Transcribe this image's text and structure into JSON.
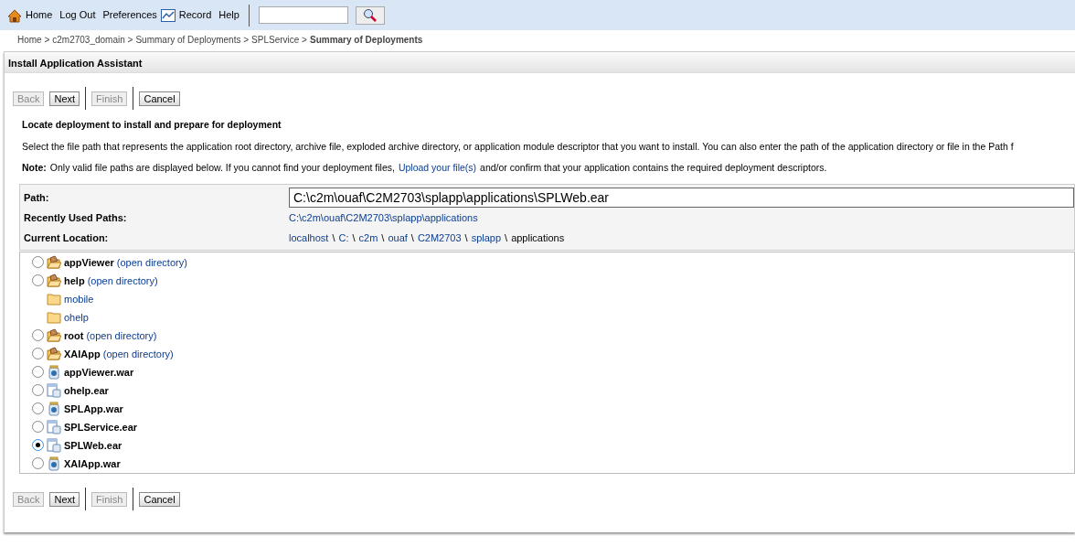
{
  "toolbar": {
    "links": [
      "Home",
      "Log Out",
      "Preferences",
      "Record",
      "Help"
    ]
  },
  "breadcrumb": [
    {
      "text": "Home >",
      "current": false
    },
    {
      "text": "c2m2703_domain >",
      "current": false
    },
    {
      "text": "Summary of Deployments >",
      "current": false
    },
    {
      "text": "SPLService >",
      "current": false
    },
    {
      "text": "Summary of Deployments",
      "current": true
    }
  ],
  "panel": {
    "title": "Install Application Assistant",
    "buttons_top": [
      {
        "label": "Back",
        "disabled": true
      },
      {
        "label": "Next",
        "disabled": false
      },
      {
        "label": "Finish",
        "disabled": true
      },
      {
        "label": "Cancel",
        "disabled": false
      }
    ],
    "heading": "Locate deployment to install and prepare for deployment",
    "description": "Select the file path that represents the application root directory, archive file, exploded archive directory, or application module descriptor that you want to install. You can also enter the path of the application directory or file in the Path f",
    "note": {
      "label": "Note:",
      "before": "Only valid file paths are displayed below. If you cannot find your deployment files,",
      "link": "Upload your file(s)",
      "after": "and/or confirm that your application contains the required deployment descriptors."
    },
    "path": {
      "label": "Path:",
      "value": "C:\\c2m\\ouaf\\C2M2703\\splapp\\applications\\SPLWeb.ear"
    },
    "recent": {
      "label": "Recently Used Paths:",
      "value": "C:\\c2m\\ouaf\\C2M2703\\splapp\\applications"
    },
    "location": {
      "label": "Current Location:",
      "segments": [
        {
          "text": "localhost",
          "kind": "link"
        },
        {
          "text": "\\",
          "kind": "sep"
        },
        {
          "text": "C:",
          "kind": "link"
        },
        {
          "text": "\\",
          "kind": "sep"
        },
        {
          "text": "c2m",
          "kind": "link"
        },
        {
          "text": "\\",
          "kind": "sep"
        },
        {
          "text": "ouaf",
          "kind": "link"
        },
        {
          "text": "\\",
          "kind": "sep"
        },
        {
          "text": "C2M2703",
          "kind": "link"
        },
        {
          "text": "\\",
          "kind": "sep"
        },
        {
          "text": "splapp",
          "kind": "link"
        },
        {
          "text": "\\",
          "kind": "sep"
        },
        {
          "text": "applications",
          "kind": "text"
        }
      ]
    },
    "items": [
      {
        "kind": "directory",
        "name": "appViewer",
        "action": "(open directory)",
        "selected": false
      },
      {
        "kind": "directory",
        "name": "help",
        "action": "(open directory)",
        "selected": false,
        "children": [
          {
            "kind": "folder",
            "name": "mobile"
          },
          {
            "kind": "folder",
            "name": "ohelp"
          }
        ]
      },
      {
        "kind": "directory",
        "name": "root",
        "action": "(open directory)",
        "selected": false
      },
      {
        "kind": "directory",
        "name": "XAIApp",
        "action": "(open directory)",
        "selected": false
      },
      {
        "kind": "war",
        "name": "appViewer.war",
        "selected": false
      },
      {
        "kind": "ear",
        "name": "ohelp.ear",
        "selected": false
      },
      {
        "kind": "war",
        "name": "SPLApp.war",
        "selected": false
      },
      {
        "kind": "ear",
        "name": "SPLService.ear",
        "selected": false
      },
      {
        "kind": "ear",
        "name": "SPLWeb.ear",
        "selected": true
      },
      {
        "kind": "war",
        "name": "XAIApp.war",
        "selected": false
      }
    ],
    "buttons_bottom": [
      {
        "label": "Back",
        "disabled": true
      },
      {
        "label": "Next",
        "disabled": false
      },
      {
        "label": "Finish",
        "disabled": true
      },
      {
        "label": "Cancel",
        "disabled": false
      }
    ]
  }
}
